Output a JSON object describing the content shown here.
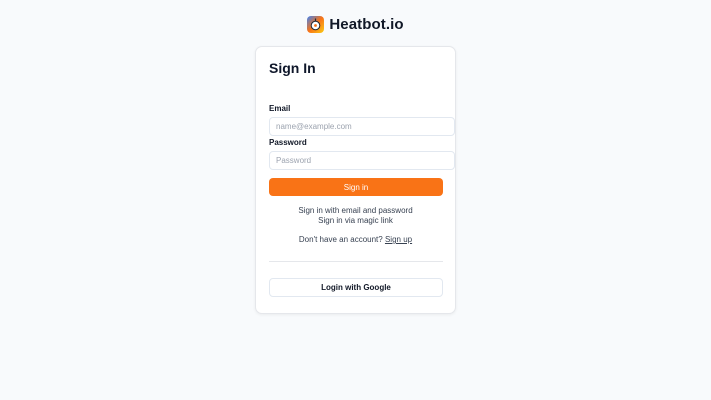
{
  "brand": {
    "name": "Heatbot.io",
    "logo_icon": "heatbot-logo-icon",
    "logo_colors": [
      "#3b82f6",
      "#f97316",
      "#facc15"
    ]
  },
  "form": {
    "title": "Sign In",
    "email_label": "Email",
    "email_placeholder": "name@example.com",
    "email_value": "",
    "password_label": "Password",
    "password_placeholder": "Password",
    "password_value": "",
    "submit_label": "Sign in",
    "submit_color": "#f97316"
  },
  "links": {
    "email_password": "Sign in with email and password",
    "magic_link": "Sign in via magic link",
    "no_account_text": "Don't have an account?",
    "signup_label": "Sign up"
  },
  "oauth": {
    "google_label": "Login with Google"
  }
}
